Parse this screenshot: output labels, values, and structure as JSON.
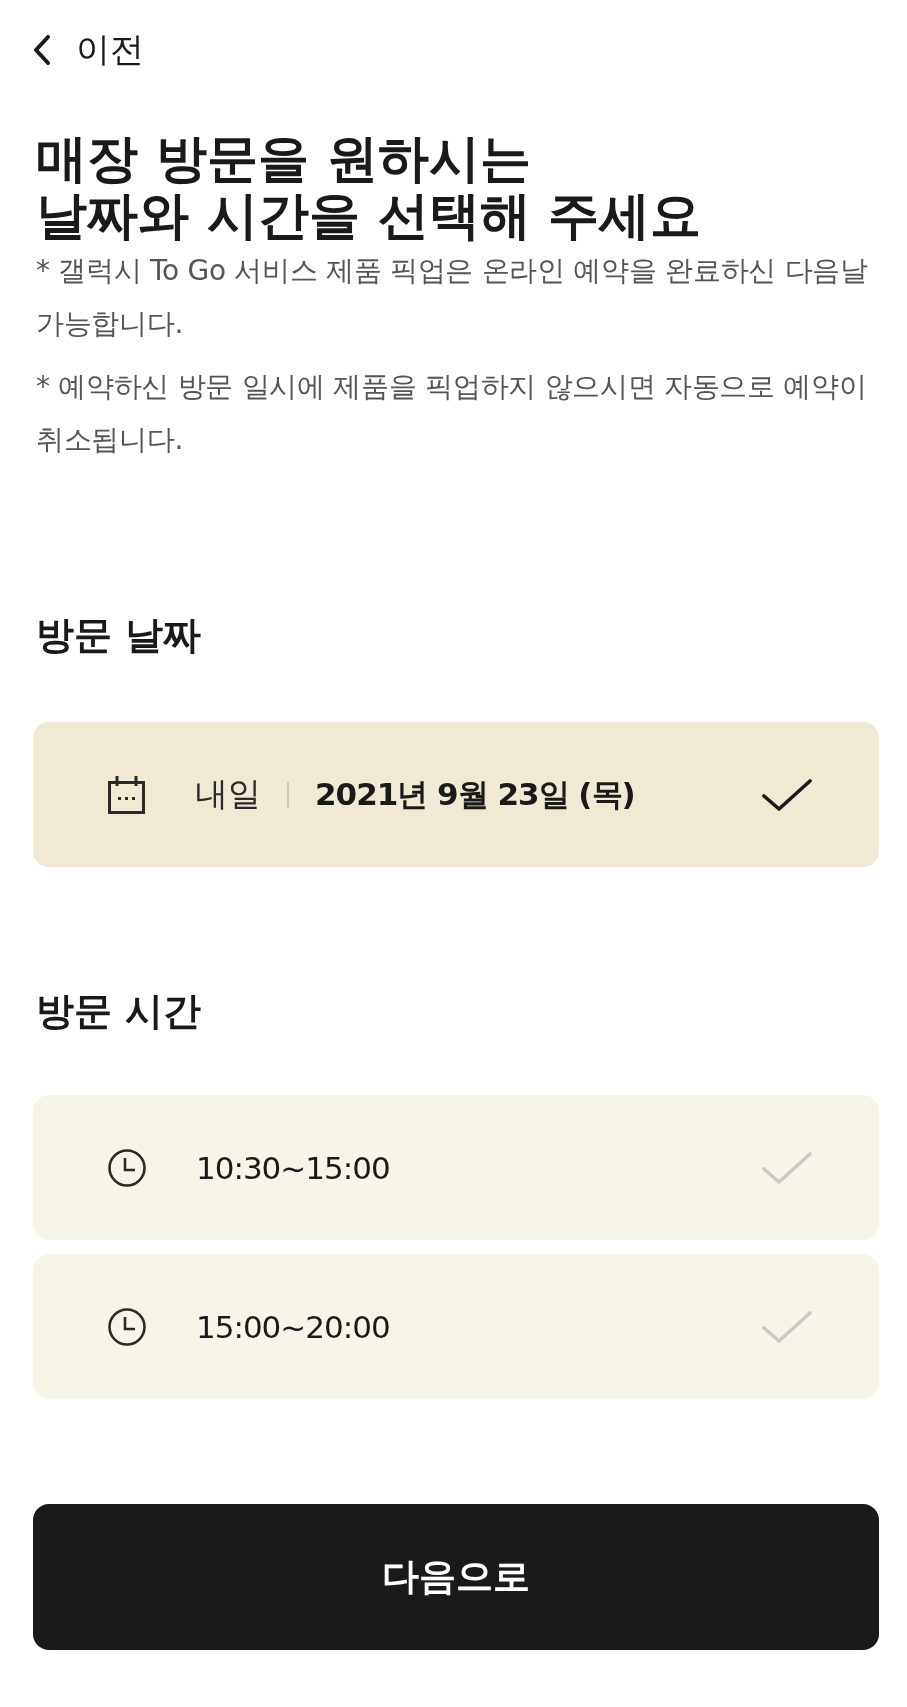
{
  "back": {
    "label": "이전"
  },
  "title_lines": [
    "매장 방문을 원하시는",
    "날짜와 시간을 선택해 주세요"
  ],
  "notes": [
    "* 갤럭시 To Go 서비스 제품 픽업은 온라인 예약을 완료하신 다음날 가능합니다.",
    "* 예약하신 방문 일시에 제품을 픽업하지 않으시면 자동으로 예약이 취소됩니다."
  ],
  "date_section": {
    "heading": "방문 날짜",
    "options": [
      {
        "label": "내일",
        "date": "2021년 9월 23일 (목)",
        "selected": true
      }
    ]
  },
  "time_section": {
    "heading": "방문 시간",
    "options": [
      {
        "time": "10:30~15:00",
        "selected": false
      },
      {
        "time": "15:00~20:00",
        "selected": false
      }
    ]
  },
  "next_button": {
    "label": "다음으로"
  }
}
